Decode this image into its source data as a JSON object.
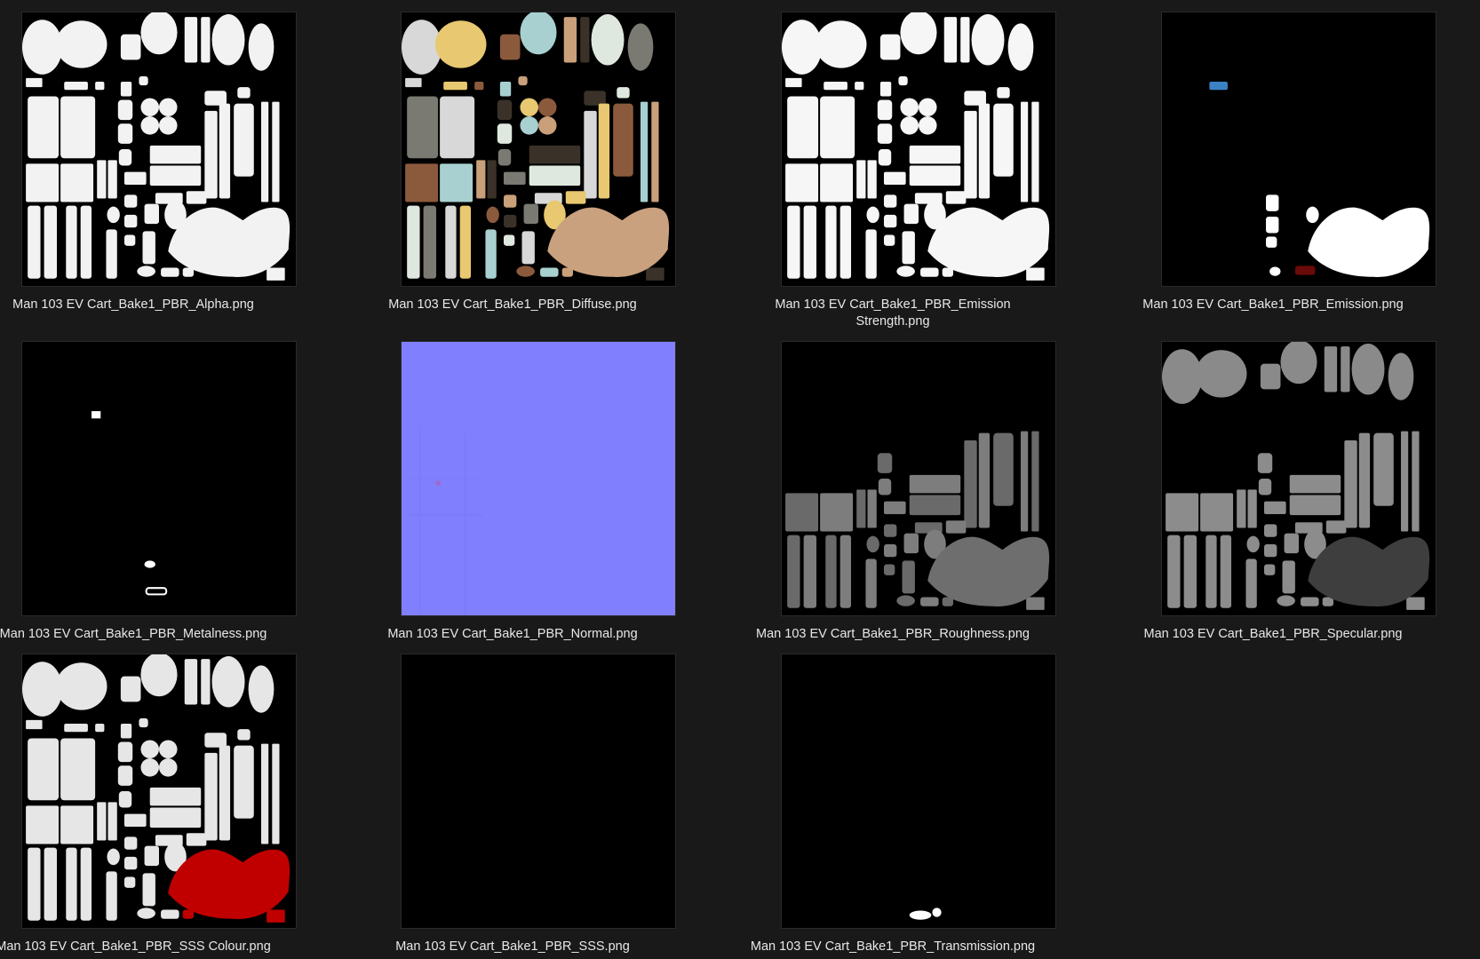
{
  "files": [
    {
      "name": "Man 103 EV Cart_Bake1_PBR_Alpha.png",
      "kind": "alpha"
    },
    {
      "name": "Man 103 EV Cart_Bake1_PBR_Diffuse.png",
      "kind": "diffuse"
    },
    {
      "name": "Man 103 EV Cart_Bake1_PBR_Emission\nStrength.png",
      "kind": "emission-strength"
    },
    {
      "name": "Man 103 EV Cart_Bake1_PBR_Emission.png",
      "kind": "emission"
    },
    {
      "name": "Man 103 EV Cart_Bake1_PBR_Metalness.png",
      "kind": "metalness"
    },
    {
      "name": "Man 103 EV Cart_Bake1_PBR_Normal.png",
      "kind": "normal"
    },
    {
      "name": "Man 103 EV Cart_Bake1_PBR_Roughness.png",
      "kind": "roughness"
    },
    {
      "name": "Man 103 EV Cart_Bake1_PBR_Specular.png",
      "kind": "specular"
    },
    {
      "name": "Man 103 EV Cart_Bake1_PBR_SSS Colour.png",
      "kind": "sss-colour"
    },
    {
      "name": "Man 103 EV Cart_Bake1_PBR_SSS.png",
      "kind": "sss"
    },
    {
      "name": "Man 103 EV Cart_Bake1_PBR_Transmission.png",
      "kind": "transmission"
    }
  ],
  "colors": {
    "background": "#191919",
    "label_text": "#e8e8e8",
    "normal_map": "#8080ff",
    "sss_red": "#c00000"
  }
}
